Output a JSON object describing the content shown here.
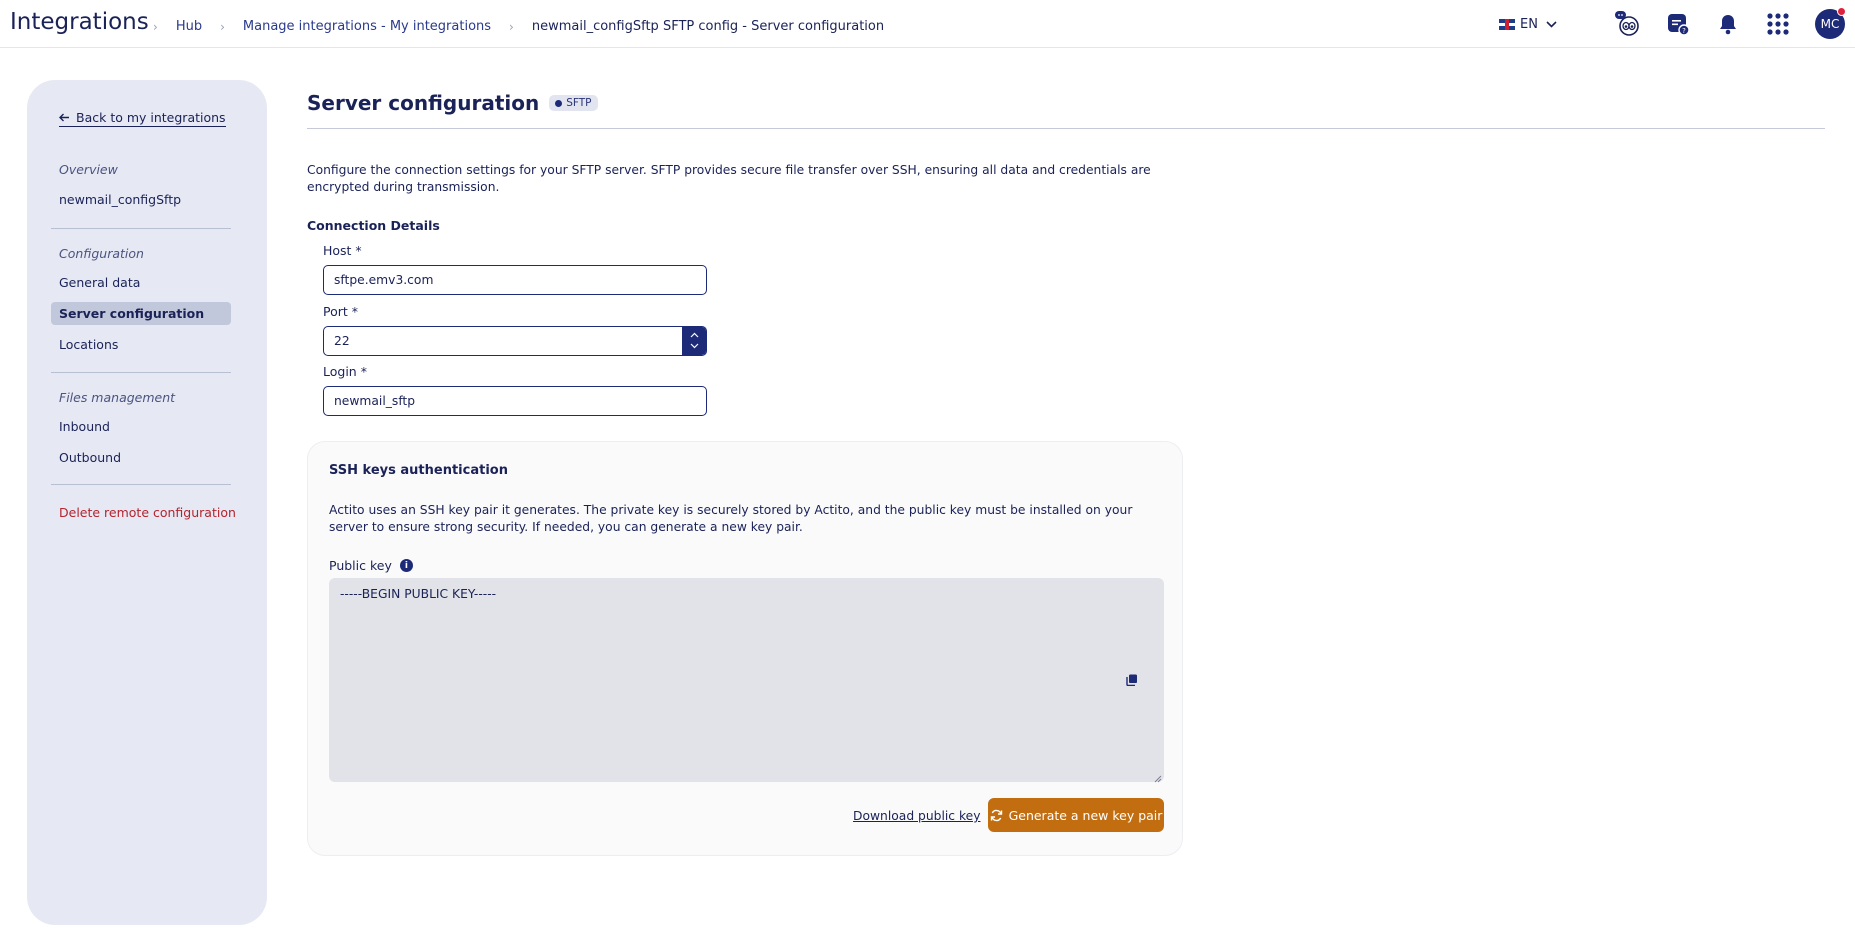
{
  "header": {
    "app_title": "Integrations",
    "breadcrumb": [
      "Hub",
      "Manage integrations - My integrations",
      "newmail_configSftp SFTP config - Server configuration"
    ],
    "language": "EN",
    "avatar_initials": "MC",
    "icons": [
      "hi-mascot-icon",
      "chat-help-icon",
      "bell-icon",
      "apps-grid-icon"
    ]
  },
  "sidebar": {
    "back_label": "Back to my integrations",
    "sections": [
      {
        "title": "Overview",
        "items": [
          "newmail_configSftp"
        ]
      },
      {
        "title": "Configuration",
        "items": [
          "General data",
          "Server configuration",
          "Locations"
        ]
      },
      {
        "title": "Files management",
        "items": [
          "Inbound",
          "Outbound"
        ]
      }
    ],
    "active_item": "Server configuration",
    "danger_action": "Delete remote configuration"
  },
  "main": {
    "title": "Server configuration",
    "badge": "SFTP",
    "description": "Configure the connection settings for your SFTP server. SFTP provides secure file transfer over SSH, ensuring all data and credentials are encrypted during transmission.",
    "connection_title": "Connection Details",
    "fields": {
      "host_label": "Host *",
      "host_value": "sftpe.emv3.com",
      "port_label": "Port *",
      "port_value": "22",
      "login_label": "Login *",
      "login_value": "newmail_sftp"
    },
    "ssh": {
      "title": "SSH keys authentication",
      "description": "Actito uses an SSH key pair it generates. The private key is securely stored by Actito, and the public key must be installed on your server to ensure strong security. If needed, you can generate a new key pair.",
      "public_key_label": "Public key",
      "public_key_value": "-----BEGIN PUBLIC KEY-----",
      "download_label": "Download public key",
      "generate_label": "Generate a new key pair"
    }
  },
  "colors": {
    "navy": "#1d2a78",
    "accent_orange": "#c26e10",
    "danger": "#b3242e",
    "sidebar_bg": "#e6e9f3"
  }
}
